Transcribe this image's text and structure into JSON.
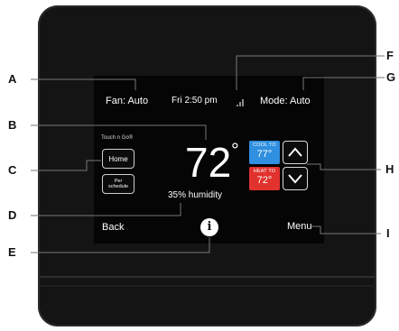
{
  "status_bar": {
    "fan": "Fan: Auto",
    "datetime": "Fri 2:50 pm",
    "mode": "Mode: Auto"
  },
  "touch_n_go": {
    "label": "Touch n Go®",
    "home_button": "Home",
    "schedule_button_line1": "Per",
    "schedule_button_line2": "schedule"
  },
  "temperature": {
    "current": "72",
    "degree_symbol": "°",
    "humidity": "35% humidity"
  },
  "setpoints": {
    "cool_label": "COOL TO",
    "cool_value": "77°",
    "heat_label": "HEAT TO",
    "heat_value": "72°"
  },
  "bottom_bar": {
    "back": "Back",
    "info": "i",
    "menu": "Menu"
  },
  "callouts": {
    "a": "A",
    "b": "B",
    "c": "C",
    "d": "D",
    "e": "E",
    "f": "F",
    "g": "G",
    "h": "H",
    "i": "I"
  },
  "colors": {
    "cool": "#2f8fe0",
    "heat": "#e2322e",
    "device": "#141414"
  },
  "icons": [
    "signal-icon",
    "arrow-up-icon",
    "arrow-down-icon",
    "info-icon"
  ]
}
